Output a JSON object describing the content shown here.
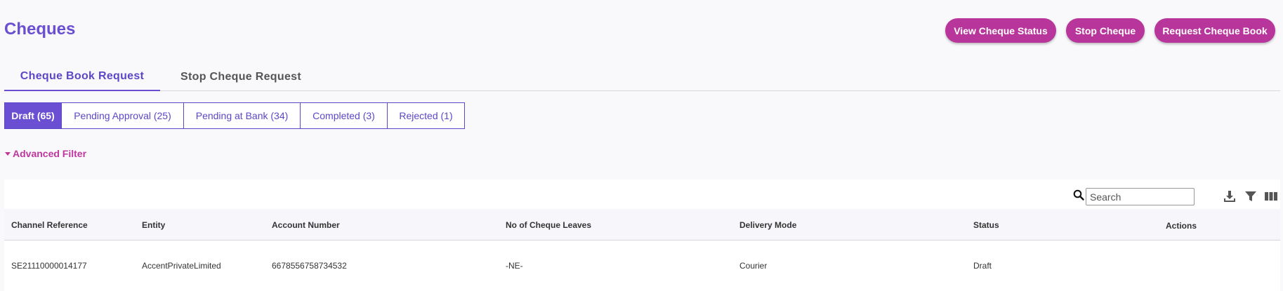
{
  "header": {
    "title": "Cheques",
    "buttons": {
      "view_status": "View Cheque Status",
      "stop": "Stop Cheque",
      "request_book": "Request Cheque Book"
    }
  },
  "main_tabs": [
    {
      "label": "Cheque Book Request",
      "active": true
    },
    {
      "label": "Stop Cheque Request",
      "active": false
    }
  ],
  "status_tabs": [
    {
      "label": "Draft (65)",
      "active": true
    },
    {
      "label": "Pending Approval (25)",
      "active": false
    },
    {
      "label": "Pending at Bank (34)",
      "active": false
    },
    {
      "label": "Completed (3)",
      "active": false
    },
    {
      "label": "Rejected (1)",
      "active": false
    }
  ],
  "advanced_filter": {
    "label": "Advanced Filter"
  },
  "toolbar": {
    "search_placeholder": "Search",
    "icons": [
      "search-icon",
      "download-icon",
      "filter-icon",
      "columns-icon"
    ]
  },
  "table": {
    "columns": [
      "Channel Reference",
      "Entity",
      "Account Number",
      "No of Cheque Leaves",
      "Delivery Mode",
      "Status",
      "Actions"
    ],
    "rows": [
      [
        "SE21110000014177",
        "AccentPrivateLimited",
        "6678556758734532",
        "-NE-",
        "Courier",
        "Draft",
        ""
      ]
    ]
  },
  "colors": {
    "primary": "#6a4fd3",
    "accent": "#b8369b",
    "filter": "#c0369f"
  }
}
